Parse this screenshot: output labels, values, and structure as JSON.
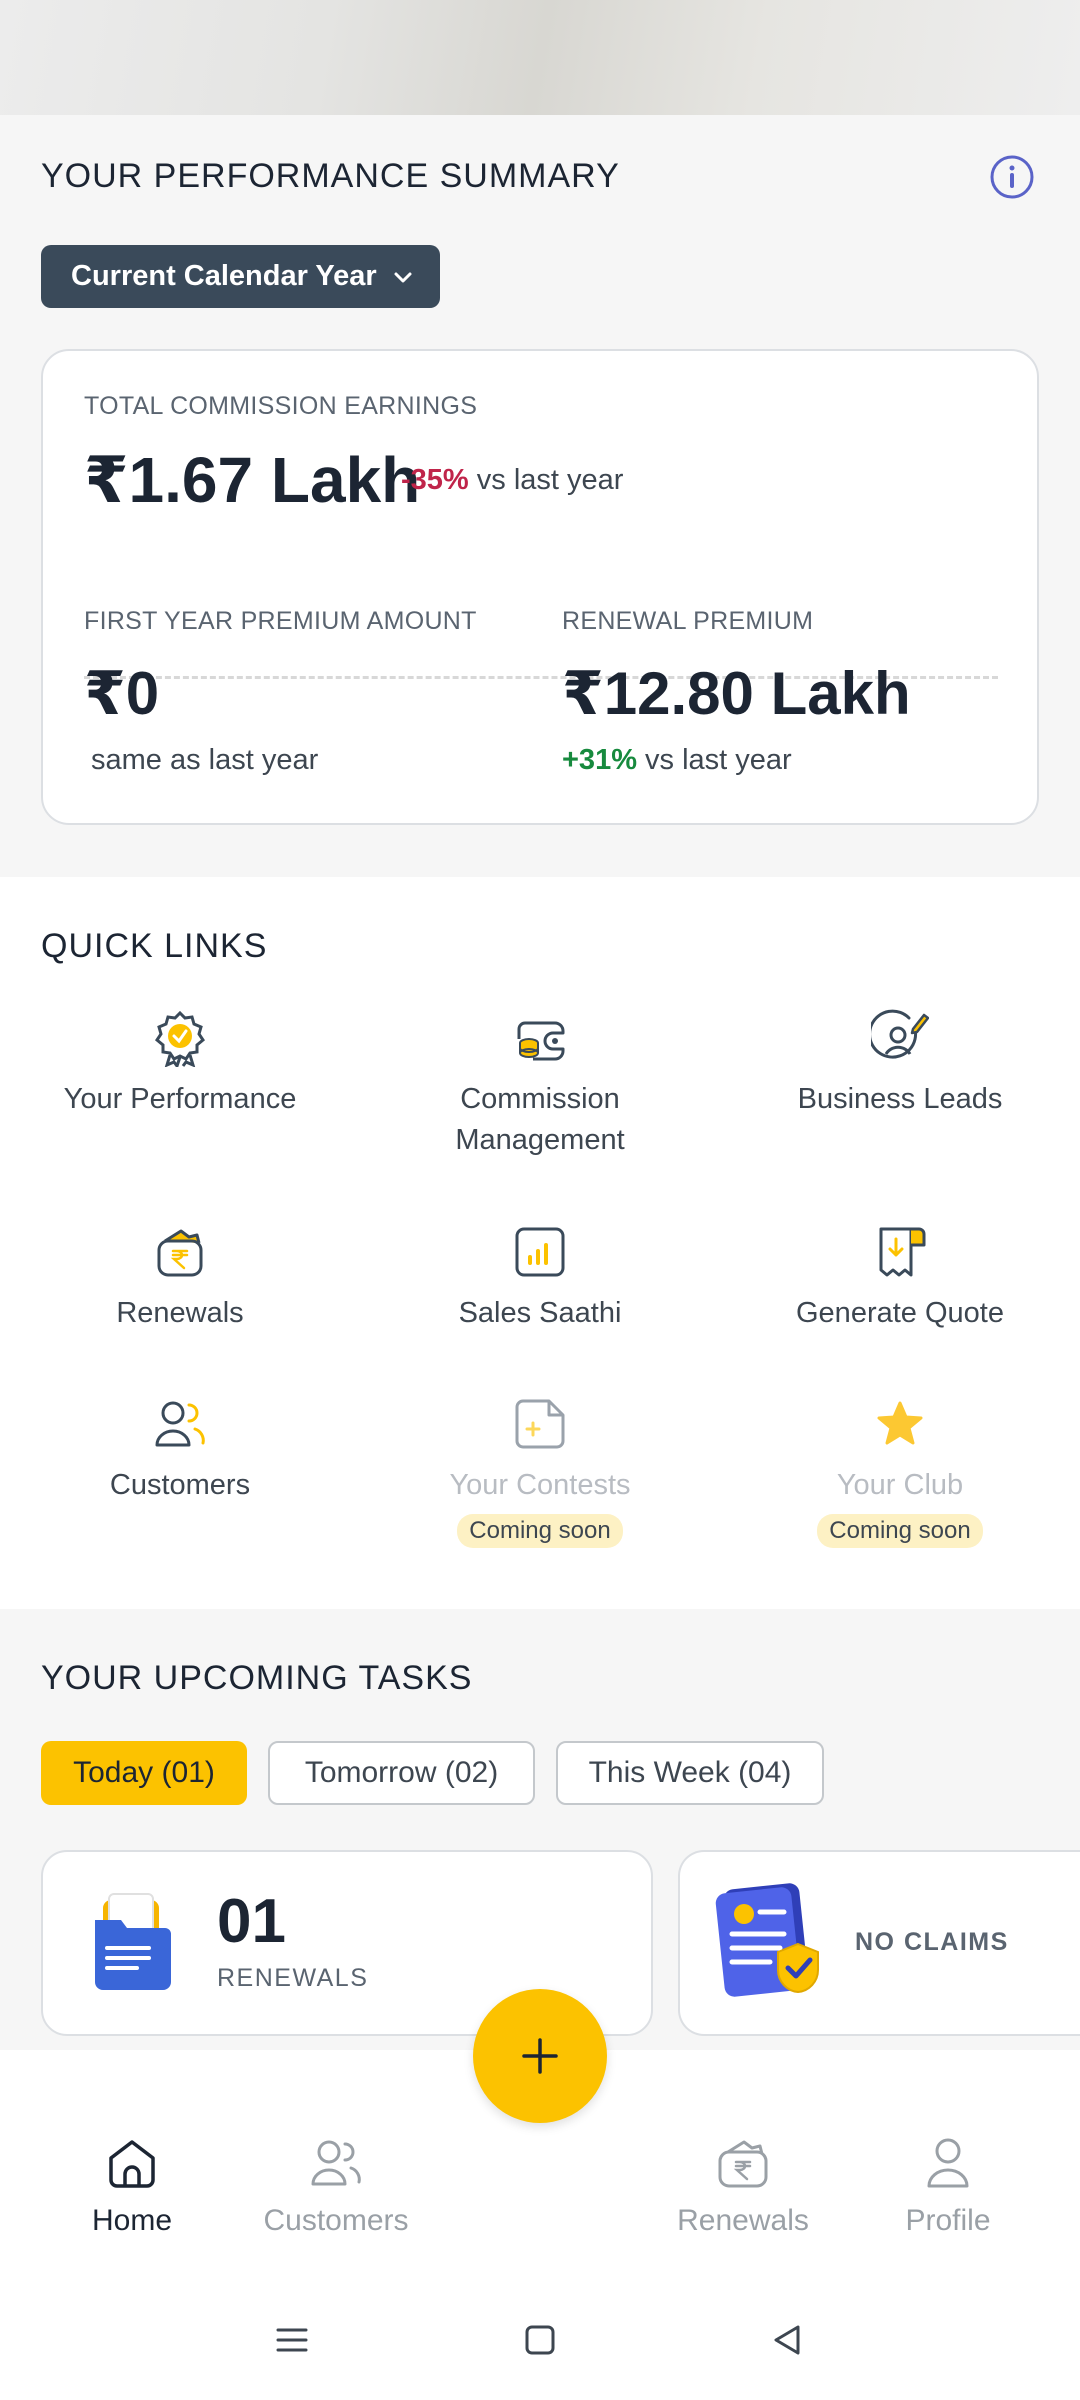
{
  "summary": {
    "title": "YOUR PERFORMANCE SUMMARY",
    "period_label": "Current Calendar Year",
    "total_commission": {
      "label": "TOTAL COMMISSION EARNINGS",
      "value": "₹1.67 Lakh",
      "change": "-35%",
      "change_suffix": "vs last year"
    },
    "first_year_premium": {
      "label": "FIRST YEAR PREMIUM AMOUNT",
      "value": "₹0",
      "note": "same as last year"
    },
    "renewal_premium": {
      "label": "RENEWAL PREMIUM",
      "value": "₹12.80 Lakh",
      "change": "+31%",
      "change_suffix": "vs last year"
    }
  },
  "quick_links": {
    "title": "QUICK LINKS",
    "items": [
      {
        "line1": "Your Performance",
        "line2": ""
      },
      {
        "line1": "Commission",
        "line2": "Management"
      },
      {
        "line1": "Business Leads",
        "line2": ""
      },
      {
        "line1": "Renewals",
        "line2": ""
      },
      {
        "line1": "Sales Saathi",
        "line2": ""
      },
      {
        "line1": "Generate Quote",
        "line2": ""
      },
      {
        "line1": "Customers",
        "line2": ""
      },
      {
        "line1": "Your Contests",
        "line2": "",
        "badge": "Coming soon"
      },
      {
        "line1": "Your Club",
        "line2": "",
        "badge": "Coming soon"
      }
    ]
  },
  "tasks": {
    "title": "YOUR UPCOMING TASKS",
    "tabs": [
      {
        "label": "Today (01)"
      },
      {
        "label": "Tomorrow (02)"
      },
      {
        "label": "This Week (04)"
      }
    ],
    "cards": [
      {
        "count": "01",
        "label": "RENEWALS"
      },
      {
        "label": "NO CLAIMS"
      }
    ]
  },
  "bottom_nav": {
    "items": [
      {
        "label": "Home"
      },
      {
        "label": "Customers"
      },
      {
        "label": "Renewals"
      },
      {
        "label": "Profile"
      }
    ]
  },
  "colors": {
    "accent": "#fcc200",
    "dark": "#3a4a5a",
    "negative": "#c0244a",
    "positive": "#178a3e",
    "info": "#5a63c8"
  }
}
